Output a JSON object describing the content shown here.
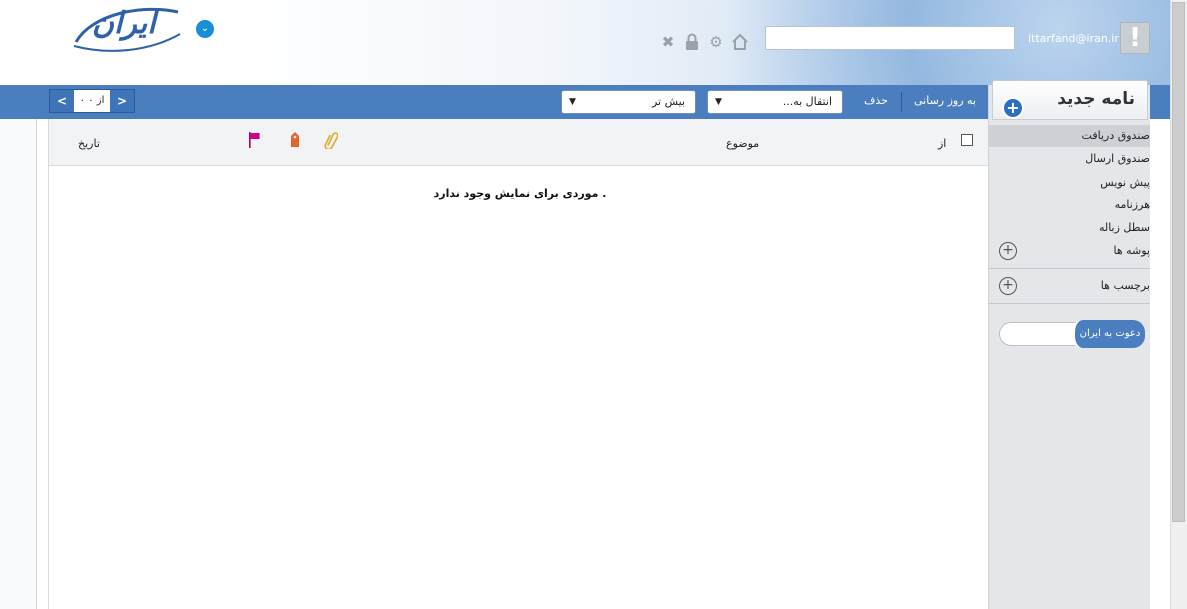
{
  "header": {
    "logo_text": "ایران",
    "user_email": "ittarfand@iran.ir",
    "search_value": "",
    "alert_glyph": "!"
  },
  "toolbar": {
    "pager": {
      "info": "۰ از ۰",
      "prev": "<",
      "next": ">"
    },
    "more_dropdown": "بیش تر",
    "move_dropdown": "انتقال به...",
    "delete": "حذف",
    "refresh": "به روز رسانی"
  },
  "compose": {
    "label": "نامه جدید"
  },
  "folders": [
    {
      "label": "صندوق دریافت"
    },
    {
      "label": "صندوق ارسال"
    },
    {
      "label": "پیش نویس"
    },
    {
      "label": "هرزنامه"
    },
    {
      "label": "سطل زباله"
    },
    {
      "label": "پوشه ها"
    }
  ],
  "labels_section": "برچسب ها",
  "invite": {
    "button": "دعوت به ایران"
  },
  "list": {
    "columns": {
      "from": "از",
      "subject": "موضوع",
      "date": "تاریخ"
    },
    "empty_message": "موردی برای نمایش وجود ندارد ."
  },
  "colors": {
    "toolbar": "#4a7ebf",
    "sidebar": "#e4e6e9",
    "accent": "#2d6fc0"
  }
}
